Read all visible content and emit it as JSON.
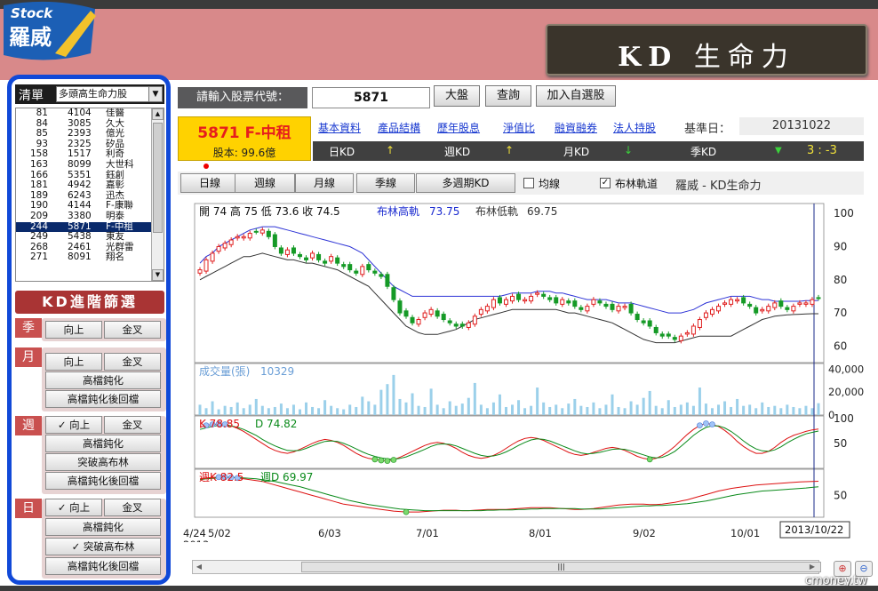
{
  "logo": {
    "small": "Stock",
    "name": "羅威"
  },
  "app_title": {
    "kd": "KD",
    "rest": "生命力"
  },
  "sidebar": {
    "list_label": "清單",
    "list_select": "多頭高生命力股",
    "stocks": [
      {
        "n": "81",
        "code": "4104",
        "name": "佳醫"
      },
      {
        "n": "84",
        "code": "3085",
        "name": "久大"
      },
      {
        "n": "85",
        "code": "2393",
        "name": "億光"
      },
      {
        "n": "93",
        "code": "2325",
        "name": "矽品"
      },
      {
        "n": "158",
        "code": "1517",
        "name": "利奇"
      },
      {
        "n": "163",
        "code": "8099",
        "name": "大世科"
      },
      {
        "n": "166",
        "code": "5351",
        "name": "鈺創"
      },
      {
        "n": "181",
        "code": "4942",
        "name": "嘉彰"
      },
      {
        "n": "189",
        "code": "6243",
        "name": "迅杰"
      },
      {
        "n": "190",
        "code": "4144",
        "name": "F-康聯"
      },
      {
        "n": "209",
        "code": "3380",
        "name": "明泰"
      },
      {
        "n": "244",
        "code": "5871",
        "name": "F-中租"
      },
      {
        "n": "249",
        "code": "5438",
        "name": "東友"
      },
      {
        "n": "268",
        "code": "2461",
        "name": "光群雷"
      },
      {
        "n": "271",
        "code": "8091",
        "name": "翔名"
      }
    ],
    "selected_index": 11,
    "kd_filter_title": "KD進階篩選",
    "groups": {
      "season": {
        "tag": "季",
        "up": "向上",
        "cross": "金叉"
      },
      "month": {
        "tag": "月",
        "up": "向上",
        "cross": "金叉",
        "opt1": "高檔鈍化",
        "opt2": "高檔鈍化後回檔"
      },
      "week": {
        "tag": "週",
        "up": "向上",
        "cross": "金叉",
        "opt1": "高檔鈍化",
        "opt2": "突破高布林",
        "opt3": "高檔鈍化後回檔",
        "check": "✓"
      },
      "day": {
        "tag": "日",
        "up": "向上",
        "cross": "金叉",
        "opt1": "高檔鈍化",
        "opt2": "突破高布林",
        "opt3": "高檔鈍化後回檔",
        "check": "✓"
      }
    }
  },
  "toolbar": {
    "input_label": "請輸入股票代號：",
    "input_value": "5871",
    "btn_market": "大盤",
    "btn_query": "查詢",
    "btn_add": "加入自選股"
  },
  "stock": {
    "title": "5871 F-中租",
    "capital": "股本: 99.6億"
  },
  "links": [
    "基本資料",
    "產品結構",
    "歷年股息",
    "淨值比",
    "融資融券",
    "法人持股"
  ],
  "ref_date": {
    "label": "基準日：",
    "value": "20131022"
  },
  "kd_strip": {
    "day": "日KD",
    "day_arrow": "↑",
    "week": "週KD",
    "week_arrow": "↑",
    "month": "月KD",
    "month_arrow": "↓",
    "season": "季KD",
    "season_arrow": "▼",
    "score": "3 : -3"
  },
  "period_buttons": [
    "日線",
    "週線",
    "月線",
    "季線",
    "多週期KD"
  ],
  "checks": {
    "ma": "均線",
    "boll": "布林軌道",
    "ma_checked": false,
    "boll_checked": true,
    "check_mark": "✓"
  },
  "chart_title": "羅威 - KD生命力",
  "status": {
    "price_info": "開 74  高 75  低 73.6  收 74.5",
    "boll_high_label": "布林高軌",
    "boll_high": "73.75",
    "boll_low_label": "布林低軌",
    "boll_low": "69.75",
    "volume_label": "成交量(張)",
    "volume": "10329",
    "k_label": "K 78.85",
    "d_label": "D 74.82",
    "wk_label": "週K 82.5",
    "wd_label": "週D 69.97"
  },
  "colors": {
    "accent_red": "#e61d1d",
    "panel_dark": "#404040",
    "sidebar_border": "#1149d8",
    "boll": "#2e34d6",
    "up": "#e02020",
    "down": "#159a26",
    "volume": "#9bd0ea"
  },
  "watermark": "cmoney.tw",
  "chart_data": [
    {
      "type": "candlestick",
      "title": "",
      "xlabel": "",
      "ylabel": "",
      "x_ticks": [
        "4/24 2013",
        "5/02",
        "6/03",
        "7/01",
        "8/01",
        "9/02",
        "10/01"
      ],
      "cursor_label": "2013/10/22",
      "y_ticks": [
        100,
        90,
        80,
        70,
        60
      ],
      "ylim": [
        55,
        103
      ],
      "close": [
        83,
        86,
        88,
        90,
        91,
        92,
        93,
        93,
        94,
        94.5,
        95,
        93,
        90,
        88,
        89,
        88,
        87,
        86,
        88,
        86,
        85,
        87,
        85,
        84,
        83,
        82,
        84,
        83,
        82,
        81,
        78,
        74,
        70,
        69,
        67,
        68,
        70,
        71,
        69,
        68,
        67,
        66,
        66,
        67,
        69,
        71,
        72,
        74,
        73,
        74,
        75,
        74,
        74,
        75,
        76,
        75,
        74,
        73,
        74,
        73,
        72,
        71,
        72,
        74,
        73,
        72,
        71,
        72,
        72,
        70,
        68,
        67,
        66,
        64,
        63,
        63,
        62,
        63,
        64,
        66,
        68,
        70,
        71,
        72,
        73,
        74,
        74,
        73,
        72,
        70,
        71,
        72,
        73,
        72,
        71,
        72,
        73,
        73,
        74,
        74.5
      ],
      "boll_high": [
        85,
        87,
        88,
        90,
        91,
        92,
        93,
        94,
        95,
        95.5,
        96,
        96,
        96,
        95.5,
        95,
        94.5,
        94,
        93.5,
        93,
        92.5,
        92,
        91.5,
        91,
        90.5,
        90,
        89,
        88,
        86,
        84,
        82,
        80,
        78,
        77,
        76,
        75,
        75,
        75,
        75,
        75,
        75,
        75,
        75,
        75,
        75,
        75,
        75,
        75,
        75,
        75,
        75.5,
        76,
        76,
        76,
        76,
        76.5,
        76.5,
        76.5,
        76,
        76,
        75.5,
        75,
        74.5,
        74,
        74,
        74,
        74,
        73.5,
        73,
        73,
        73,
        72.5,
        72,
        71.5,
        71,
        70.5,
        70,
        70,
        70,
        70.5,
        71,
        72,
        73,
        73.5,
        74,
        74.5,
        75,
        75,
        75,
        75,
        74.5,
        74,
        74,
        73.5,
        73.5,
        73.5,
        73.5,
        73.5,
        73.7,
        73.7,
        73.75
      ],
      "boll_low": [
        80,
        81,
        82,
        83,
        84,
        85,
        86,
        87,
        87,
        87.5,
        88,
        87.5,
        87,
        86.5,
        86,
        86,
        85.5,
        85,
        85,
        84.5,
        84,
        83.5,
        83,
        82,
        81,
        80,
        79,
        78,
        76,
        74,
        72,
        70,
        68,
        66,
        65,
        64,
        63.5,
        63.5,
        63.5,
        64,
        64.5,
        65,
        66,
        67,
        68,
        68.5,
        69,
        69.5,
        70,
        70.5,
        71,
        71,
        71,
        71,
        71,
        71,
        71,
        71,
        70.5,
        70,
        70,
        69.5,
        69,
        68.5,
        68,
        67.5,
        67,
        66,
        65,
        64,
        63,
        62,
        61.5,
        61,
        61,
        61,
        61,
        61.5,
        62,
        62.5,
        63,
        63,
        63,
        63,
        63,
        63,
        64,
        65,
        66,
        67,
        68,
        68.5,
        69,
        69.2,
        69.4,
        69.5,
        69.6,
        69.7,
        69.75,
        69.75
      ]
    },
    {
      "type": "bar",
      "title": "",
      "y_ticks": [
        "40,000",
        "20,000",
        "0"
      ],
      "ylim": [
        0,
        45000
      ],
      "values": [
        9000,
        6000,
        12000,
        5000,
        8000,
        7000,
        11000,
        6000,
        9000,
        14000,
        8000,
        6000,
        7000,
        10000,
        6000,
        9000,
        5000,
        11000,
        7000,
        6000,
        13000,
        8000,
        6000,
        5000,
        9000,
        7000,
        16000,
        12000,
        9000,
        22000,
        27000,
        35000,
        14000,
        11000,
        19000,
        8000,
        7000,
        23000,
        9000,
        6000,
        12000,
        8000,
        10000,
        15000,
        28000,
        9000,
        6000,
        11000,
        18000,
        7000,
        9000,
        13000,
        6000,
        8000,
        24000,
        11000,
        7000,
        9000,
        6000,
        10000,
        14000,
        8000,
        7000,
        11000,
        6000,
        9000,
        18000,
        7000,
        6000,
        12000,
        9000,
        15000,
        21000,
        8000,
        6000,
        13000,
        7000,
        9000,
        11000,
        8000,
        24000,
        10000,
        6000,
        9000,
        12000,
        7000,
        14000,
        8000,
        9000,
        6000,
        11000,
        7000,
        8000,
        6000,
        9000,
        7000,
        6000,
        8000,
        6000,
        10329
      ]
    },
    {
      "type": "line",
      "title": "",
      "y_ticks": [
        100,
        50
      ],
      "ylim": [
        0,
        105
      ],
      "series": [
        {
          "name": "K 78.85",
          "values": [
            82,
            86,
            88,
            89,
            88,
            85,
            80,
            74,
            66,
            58,
            50,
            42,
            36,
            32,
            30,
            33,
            38,
            44,
            50,
            55,
            58,
            56,
            52,
            46,
            38,
            30,
            24,
            20,
            18,
            16,
            15,
            17,
            22,
            28,
            34,
            40,
            46,
            50,
            52,
            50,
            46,
            40,
            32,
            26,
            22,
            20,
            22,
            26,
            32,
            40,
            48,
            55,
            60,
            62,
            60,
            56,
            50,
            44,
            38,
            32,
            28,
            26,
            28,
            32,
            36,
            40,
            42,
            40,
            36,
            30,
            24,
            20,
            18,
            20,
            26,
            34,
            44,
            56,
            68,
            78,
            86,
            90,
            88,
            84,
            76,
            66,
            54,
            44,
            36,
            30,
            30,
            34,
            42,
            52,
            60,
            66,
            70,
            74,
            77,
            78.85
          ]
        },
        {
          "name": "D 74.82",
          "values": [
            78,
            81,
            84,
            86,
            86,
            85,
            82,
            78,
            72,
            66,
            58,
            51,
            45,
            40,
            36,
            35,
            36,
            40,
            45,
            50,
            54,
            55,
            54,
            50,
            45,
            39,
            33,
            28,
            24,
            21,
            19,
            18,
            20,
            23,
            28,
            33,
            38,
            44,
            48,
            49,
            48,
            45,
            40,
            35,
            30,
            26,
            24,
            25,
            28,
            33,
            39,
            46,
            52,
            57,
            59,
            58,
            55,
            50,
            45,
            40,
            35,
            31,
            29,
            30,
            32,
            35,
            38,
            39,
            38,
            35,
            31,
            27,
            23,
            21,
            22,
            27,
            34,
            44,
            55,
            66,
            75,
            82,
            85,
            85,
            81,
            74,
            65,
            55,
            46,
            39,
            35,
            34,
            37,
            43,
            51,
            58,
            64,
            69,
            72,
            74.82
          ]
        }
      ]
    },
    {
      "type": "line",
      "title": "",
      "y_ticks": [
        50
      ],
      "ylim": [
        0,
        110
      ],
      "series": [
        {
          "name": "週K 82.5",
          "values": [
            88,
            90,
            91,
            92,
            92,
            91,
            90,
            88,
            86,
            84,
            82,
            78,
            74,
            70,
            66,
            62,
            58,
            54,
            50,
            46,
            42,
            38,
            34,
            30,
            28,
            26,
            24,
            22,
            20,
            18,
            16,
            14,
            13,
            12,
            12,
            12,
            13,
            14,
            15,
            16,
            16,
            16,
            15,
            15,
            16,
            17,
            18,
            18,
            18,
            18,
            19,
            20,
            21,
            22,
            22,
            22,
            22,
            21,
            20,
            19,
            18,
            18,
            19,
            20,
            22,
            24,
            26,
            28,
            29,
            30,
            30,
            30,
            29,
            29,
            30,
            32,
            34,
            37,
            40,
            44,
            48,
            52,
            56,
            60,
            63,
            66,
            68,
            70,
            72,
            74,
            75,
            76,
            77,
            78,
            79,
            80,
            81,
            81.5,
            82,
            82.5
          ]
        },
        {
          "name": "週D 69.97",
          "values": [
            86,
            88,
            89,
            90,
            91,
            91,
            91,
            90,
            89,
            88,
            86,
            84,
            82,
            79,
            76,
            73,
            70,
            66,
            62,
            58,
            54,
            50,
            46,
            42,
            38,
            35,
            32,
            29,
            27,
            25,
            23,
            21,
            19,
            18,
            17,
            16,
            15,
            15,
            15,
            15,
            15,
            15,
            15,
            15,
            15,
            15,
            16,
            16,
            17,
            17,
            17,
            18,
            18,
            19,
            19,
            20,
            20,
            20,
            20,
            20,
            20,
            19,
            19,
            19,
            19,
            20,
            21,
            22,
            23,
            24,
            25,
            26,
            26,
            27,
            27,
            28,
            29,
            30,
            31,
            33,
            35,
            37,
            40,
            43,
            46,
            49,
            52,
            54,
            56,
            58,
            60,
            61,
            62,
            63,
            64,
            65,
            66,
            67,
            68.5,
            69.97
          ]
        }
      ]
    }
  ]
}
